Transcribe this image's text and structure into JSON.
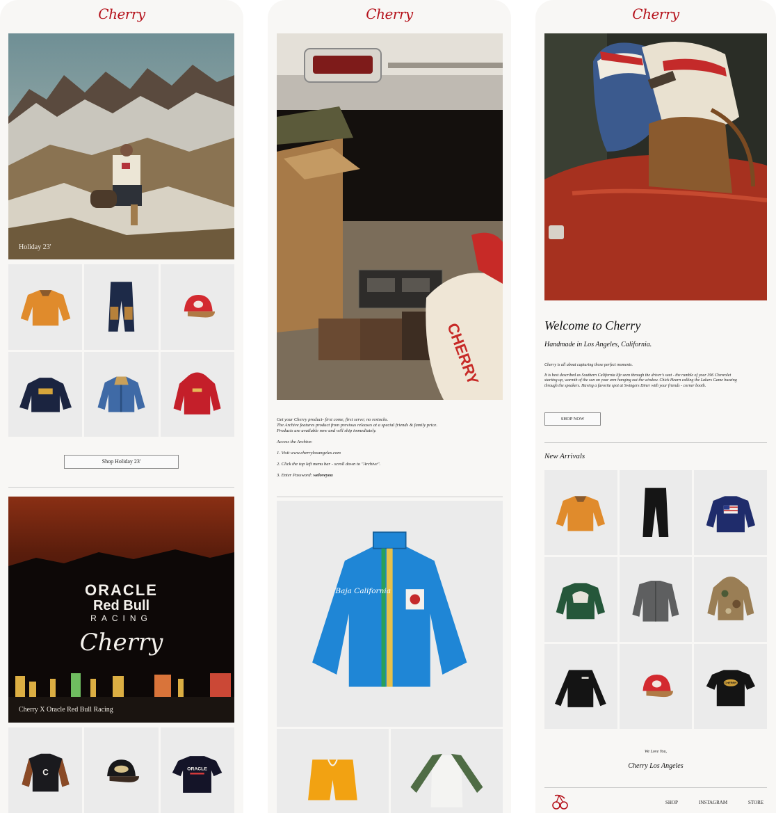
{
  "brand": {
    "logo_text": "Cherry",
    "logo_color": "#b5121b"
  },
  "column1": {
    "hero_caption": "Holiday 23'",
    "shop_button": "Shop Holiday 23'",
    "collab_logo_line1": "ORACLE",
    "collab_logo_line2": "Red Bull",
    "collab_logo_line3": "RACING",
    "collab_logo_cherry": "Cherry",
    "collab_caption": "Cherry X Oracle Red Bull Racing",
    "tee_print": "ORACLE",
    "hat_patch": "Cherry"
  },
  "column2": {
    "intro_line1": "Get your Cherry product- first come, first serve; no restocks.",
    "intro_line2": "The Archive features product from previous releases at a special friends & family price.",
    "intro_line3": "Products are available now and will ship immediately.",
    "access_heading": "Access the Archive:",
    "step1": "1. Visit www.cherrylosangeles.com",
    "step2": "2. Click the top left menu bar - scroll down to \"Archive\".",
    "step3_prefix": "3. Enter Password: ",
    "step3_password": "weloveyou",
    "jacket_script": "Baja California"
  },
  "column3": {
    "welcome_title": "Welcome to Cherry",
    "subtitle": "Handmade in Los Angeles, California.",
    "para1": "Cherry is all about capturing those perfect moments.",
    "para2": "It is best described as Southern California life seen through the driver’s seat - the rumble of your 396 Chevrolet starting up, warmth of the sun on your arm hanging out the window. Chick Hearn calling the Lakers Game buzzing through the speakers. Having a favorite spot at Swingers Diner with your friends - corner booth.",
    "shop_now": "SHOP NOW",
    "new_arrivals": "New Arrivals",
    "we_love_you": "We Love You,",
    "signoff": "Cherry Los Angeles",
    "footer_shop": "SHOP",
    "footer_instagram": "INSTAGRAM",
    "footer_store": "STORE",
    "tee_print": "CHERRY"
  }
}
